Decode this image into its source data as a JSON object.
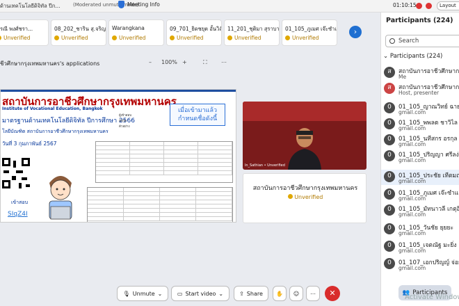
{
  "titlebar": {
    "title": "ด้านเทคโนโลยีดิจิทัล ปีก...",
    "moderated": "(Moderated unmute mode)",
    "meeting_info": "Meeting Info",
    "time": "01:10:15",
    "layout": "Layout"
  },
  "thumbs": [
    {
      "name": "ภรณี พงศ์ชรา...",
      "status": "Unverified"
    },
    {
      "name": "08_202_ชาริน สุ.จริญ",
      "status": "Unverified"
    },
    {
      "name": "Warangkana",
      "status": "Unverified"
    },
    {
      "name": "09_701_ยิดชยุต อั้นวิสัย",
      "status": "Unverified"
    },
    {
      "name": "11_201_ชุติมา สุราบาง",
      "status": "Unverified"
    },
    {
      "name": "01_105_ภูเมศ เจ๊ะซำและ",
      "status": "Unverified"
    }
  ],
  "share": {
    "label": "ชีวศึกษากรุงเทพมหานคร's applications",
    "minus": "–",
    "zoom": "100%",
    "plus": "+"
  },
  "slide": {
    "title": "สถาบันการอาชีวศึกษากรุงเทพมหานคร",
    "subtitle": "Institute of Vocational Education, Bangkok",
    "line1": "มาตรฐานด้านเทคโนโลยีดิจิทัล ปีการศึกษา 2566",
    "line2": "โลยีบัณฑิต สถาบันการอาชีวศึกษากรุงเทพมหานคร",
    "date": "วันที่ 3 กุมภาพันธ์ 2567",
    "callout1": "เมื่อเข้ามาแล้ว",
    "callout2": "กำหนดชื่อดังนี้",
    "meta1": "ผู้เข้าสอบ",
    "meta2": "สังกัด",
    "meta3": "ตัวอย่าง",
    "test": "เข้าสอบ",
    "link": "SIqZ4I"
  },
  "video": {
    "name": "ln_Sathian • Unverified",
    "banner": "สถาบันการอาชีวศึกษากรุงเทพมหานคร"
  },
  "tile": {
    "name": "สถาบันการอาชีวศึกษากรุงเทพมหานคร",
    "status": "Unverified"
  },
  "toolbar": {
    "unmute": "Unmute",
    "start_video": "Start video",
    "share": "Share"
  },
  "panel": {
    "header": "Participants (224)",
    "search_placeholder": "Search",
    "section": "Participants (224)",
    "items": [
      {
        "initial": "ส",
        "name": "สถาบันการอาชีวศึกษากรุ...",
        "sub": "Me"
      },
      {
        "initial": "ส",
        "name": "สถาบันการอาชีวศึกษากรุ...",
        "sub": "Host, presenter"
      },
      {
        "initial": "0",
        "name": "01_105_ญาณวิทย์ ฉายพ...",
        "sub": "gmail.com"
      },
      {
        "initial": "0",
        "name": "01_105_พพลด ชาวิไล",
        "sub": "gmail.com"
      },
      {
        "initial": "0",
        "name": "01_105_นทีสกร อรกุล",
        "sub": "gmail.com"
      },
      {
        "initial": "0",
        "name": "01_105_ปริญญา ศรีลง่า",
        "sub": "gmail.com"
      },
      {
        "initial": "0",
        "name": "01_105_ประชัย เทีตมณฑ...",
        "sub": "gmail.com"
      },
      {
        "initial": "0",
        "name": "01_105_ภูเมศ เจ๊ะซำและ",
        "sub": "gmail.com"
      },
      {
        "initial": "0",
        "name": "01_105_มัทนาวลี เกตุอินท...",
        "sub": "gmail.com"
      },
      {
        "initial": "0",
        "name": "01_105_วันชัย ยุยยะ",
        "sub": "gmail.com"
      },
      {
        "initial": "0",
        "name": "01_105_เจตณัฐ มะยิ่ง",
        "sub": "gmail.com"
      },
      {
        "initial": "0",
        "name": "01_107_เอกปริญญ์ จ่อยรุ่...",
        "sub": "gmail.com"
      }
    ],
    "participants_btn": "Participants",
    "activate": "Activate Window"
  }
}
